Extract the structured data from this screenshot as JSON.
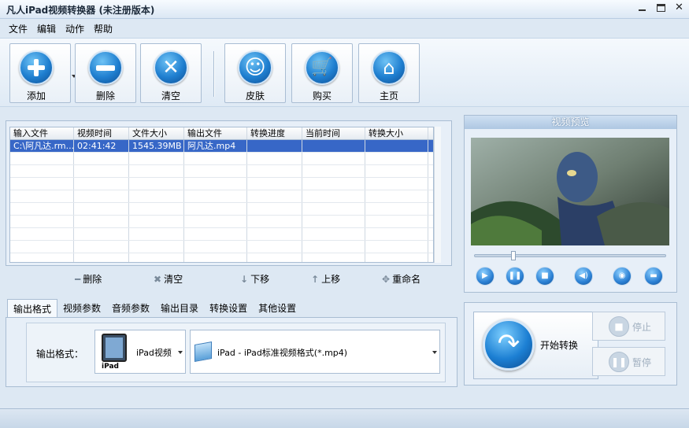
{
  "window": {
    "title": "凡人iPad视频转换器  (未注册版本)"
  },
  "menu": [
    "文件",
    "编辑",
    "动作",
    "帮助"
  ],
  "toolbar": {
    "add": "添加",
    "delete": "删除",
    "clear": "清空",
    "skin": "皮肤",
    "buy": "购买",
    "home": "主页"
  },
  "table": {
    "headers": [
      "输入文件",
      "视频时间",
      "文件大小",
      "输出文件",
      "转换进度",
      "当前时间",
      "转换大小"
    ],
    "rows": [
      [
        "C:\\阿凡达.rm...",
        "02:41:42",
        "1545.39MB",
        "阿凡达.mp4",
        "",
        "",
        ""
      ]
    ]
  },
  "list_actions": {
    "delete": "删除",
    "clear": "清空",
    "down": "下移",
    "up": "上移",
    "rename": "重命名"
  },
  "preview": {
    "title": "视频预览"
  },
  "tabs": [
    "输出格式",
    "视频参数",
    "音频参数",
    "输出目录",
    "转换设置",
    "其他设置"
  ],
  "output": {
    "label": "输出格式：",
    "device": "iPad视频",
    "device_caption": "iPad",
    "format": "iPad - iPad标准视频格式(*.mp4)"
  },
  "convert": {
    "start": "开始转换",
    "stop": "停止",
    "pause": "暂停"
  }
}
